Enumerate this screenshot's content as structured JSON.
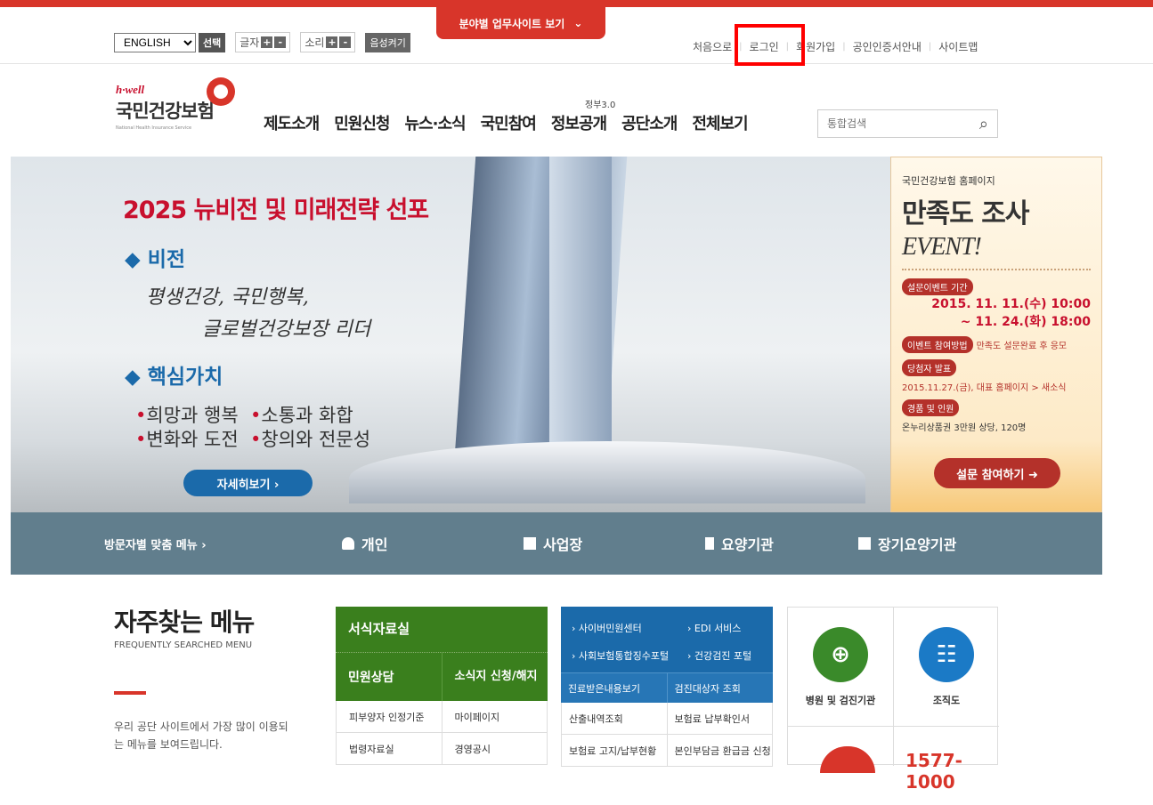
{
  "util": {
    "language": "ENGLISH",
    "select_label": "선택",
    "font_label": "글자",
    "sound_label": "소리",
    "plus": "+",
    "minus": "-",
    "voice_label": "음성켜기"
  },
  "dropdown_tab": {
    "label": "분야별 업무사이트 보기",
    "chevron": "⌄"
  },
  "toplinks": [
    "처음으로",
    "로그인",
    "회원가입",
    "공인인증서안내",
    "사이트맵"
  ],
  "logo": {
    "hwell": "h·well",
    "name": "국민건강보험",
    "english": "National Health Insurance Service"
  },
  "gnb": [
    "제도소개",
    "민원신청",
    "뉴스·소식",
    "국민참여",
    "정보공개",
    "공단소개",
    "전체보기"
  ],
  "gnb_sub": "정부3.0",
  "search": {
    "placeholder": "통합검색",
    "icon": "⌕"
  },
  "hero": {
    "title": "2025 뉴비전 및 미래전략 선포",
    "vision_head": "◆ 비전",
    "vision_line1": "평생건강, 국민행복,",
    "vision_line2": "글로벌건강보장 리더",
    "values_head": "◆ 핵심가치",
    "values_row1a": "희망과 행복",
    "values_row1b": "소통과 화합",
    "values_row2a": "변화와 도전",
    "values_row2b": "창의와 전문성",
    "bullet": "•",
    "more": "자세히보기 ›"
  },
  "event": {
    "small": "국민건강보험 홈페이지",
    "big": "만족도 조사",
    "big_en": "EVENT!",
    "period_label": "설문이벤트 기간",
    "period_line1": "2015. 11. 11.(수) 10:00",
    "period_line2": "~ 11. 24.(화) 18:00",
    "method_label": "이벤트 참여방법",
    "method_text": "만족도 설문완료 후 응모",
    "winner_label": "당첨자 발표",
    "winner_text": "2015.11.27.(금), 대표 홈페이지 > 새소식",
    "prize_label": "경품 및 인원",
    "prize_text": "온누리상품권 3만원 상당, 120명",
    "button": "설문 참여하기 ➜"
  },
  "visitor": {
    "title": "방문자별 맞춤 메뉴 ›",
    "items": [
      "개인",
      "사업장",
      "요양기관",
      "장기요양기관"
    ]
  },
  "freq": {
    "title": "자주찾는 메뉴",
    "english": "FREQUENTLY SEARCHED MENU",
    "desc": "우리 공단 사이트에서 가장 많이 이용되는 메뉴를 보여드립니다."
  },
  "green": {
    "head": "서식자료실",
    "row2a": "민원상담",
    "row2b": "소식지 신청/해지",
    "cells": [
      [
        "피부양자 인정기준",
        "마이페이지"
      ],
      [
        "법령자료실",
        "경영공시"
      ]
    ]
  },
  "blue": {
    "links": [
      "사이버민원센터",
      "EDI 서비스",
      "사회보험통합징수포털",
      "건강검진 포털"
    ],
    "row": [
      "진료받은내용보기",
      "검진대상자 조회"
    ],
    "cells": [
      [
        "산출내역조회",
        "보험료 납부확인서"
      ],
      [
        "보험료 고지/납부현황",
        "본인부담금 환급금 신청"
      ]
    ]
  },
  "quick": {
    "hospital": "병원 및 검진기관",
    "org": "조직도",
    "tel": "1577-1000"
  },
  "colors": {
    "brand_red": "#d8352a",
    "green": "#3a7f1d",
    "blue": "#1b6aaa",
    "visitor_bar": "#617e8d"
  }
}
